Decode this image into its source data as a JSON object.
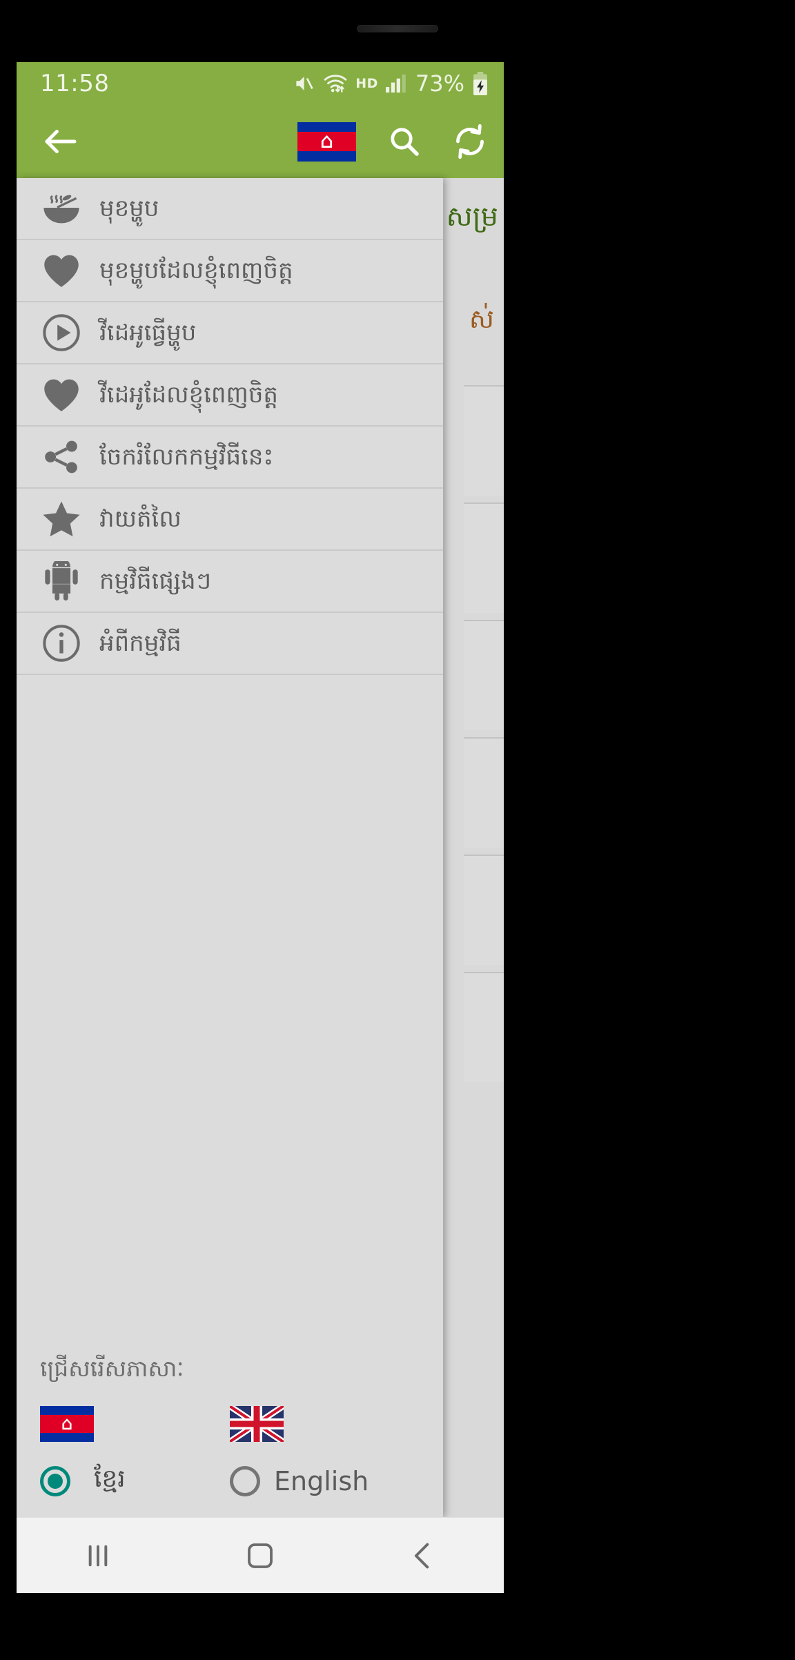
{
  "status_bar": {
    "time": "11:58",
    "hd_label": "HD",
    "battery_percent": "73%",
    "icons": [
      "mute-icon",
      "wifi-icon",
      "hd-label",
      "signal-icon",
      "battery-charging-icon"
    ]
  },
  "app_bar": {
    "back_icon": "back-arrow-icon",
    "flag_icon": "cambodia-flag-icon",
    "flag_glyph": "⌂",
    "search_icon": "search-icon",
    "refresh_icon": "refresh-icon"
  },
  "content_behind": {
    "title": "សម្រ",
    "subtitle": "ស់"
  },
  "drawer": {
    "items": [
      {
        "label": "មុខម្ហូប",
        "icon": "soup-bowl-icon"
      },
      {
        "label": "មុខម្ហូបដែលខ្ញុំពេញចិត្ត",
        "icon": "heart-icon"
      },
      {
        "label": "វីដេអូធ្វើម្ហូប",
        "icon": "play-circle-icon"
      },
      {
        "label": "វីដេអូដែលខ្ញុំពេញចិត្ត",
        "icon": "heart-icon"
      },
      {
        "label": "ចែករំលែកកម្មវិធីនេះ",
        "icon": "share-icon"
      },
      {
        "label": "វាយតំលៃ",
        "icon": "star-icon"
      },
      {
        "label": "កម្មវិធីផ្សេងៗ",
        "icon": "android-robot-icon"
      },
      {
        "label": "អំពីកម្មវិធី",
        "icon": "info-circle-icon"
      }
    ]
  },
  "language_section": {
    "title": "ជ្រើសរើសភាសាៈ",
    "options": [
      {
        "label": "ខ្មែរ",
        "flag": "cambodia-flag-icon",
        "selected": true
      },
      {
        "label": "English",
        "flag": "uk-flag-icon",
        "selected": false
      }
    ],
    "selected_color": "#00897b"
  },
  "nav_bar": {
    "recents_icon": "recents-icon",
    "home_icon": "home-icon",
    "back_icon": "nav-back-icon"
  },
  "colors": {
    "accent_green": "#86ae42",
    "drawer_bg": "#dcdcdc",
    "icon_gray": "#6b6b6b",
    "teal": "#00897b"
  }
}
